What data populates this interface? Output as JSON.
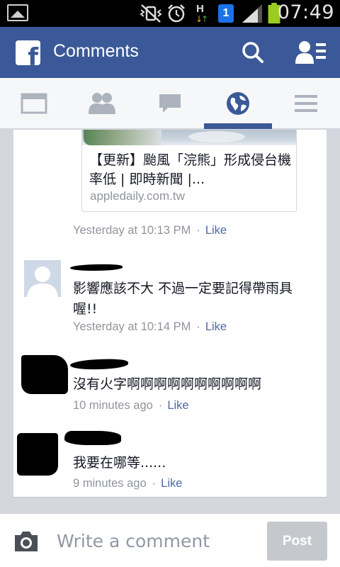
{
  "status_bar": {
    "time": "07:49",
    "network_type": "H",
    "notification_badge": "1"
  },
  "header": {
    "title": "Comments"
  },
  "nav_tabs": [
    {
      "name": "news-feed",
      "active": false
    },
    {
      "name": "friends",
      "active": false
    },
    {
      "name": "messages",
      "active": false
    },
    {
      "name": "notifications",
      "active": true
    },
    {
      "name": "more",
      "active": false
    }
  ],
  "link_preview": {
    "title": "【更新】颱風「浣熊」形成侵台機率低 | 即時新聞 |...",
    "domain": "appledaily.com.tw",
    "timestamp": "Yesterday at 10:13 PM",
    "like_label": "Like"
  },
  "comments": [
    {
      "text": "影響應該不大 不過一定要記得帶雨具喔!!",
      "timestamp": "Yesterday at 10:14 PM",
      "like_label": "Like"
    },
    {
      "text": "沒有火字啊啊啊啊啊啊啊啊啊啊",
      "timestamp": "10 minutes ago",
      "like_label": "Like"
    },
    {
      "text": "我要在哪等......",
      "timestamp": "9 minutes ago",
      "like_label": "Like"
    }
  ],
  "composer": {
    "placeholder": "Write a comment",
    "post_label": "Post"
  },
  "colors": {
    "brand": "#3b5998",
    "link": "#4e69a2",
    "meta": "#90949c",
    "battery": "#9ccc1e"
  }
}
